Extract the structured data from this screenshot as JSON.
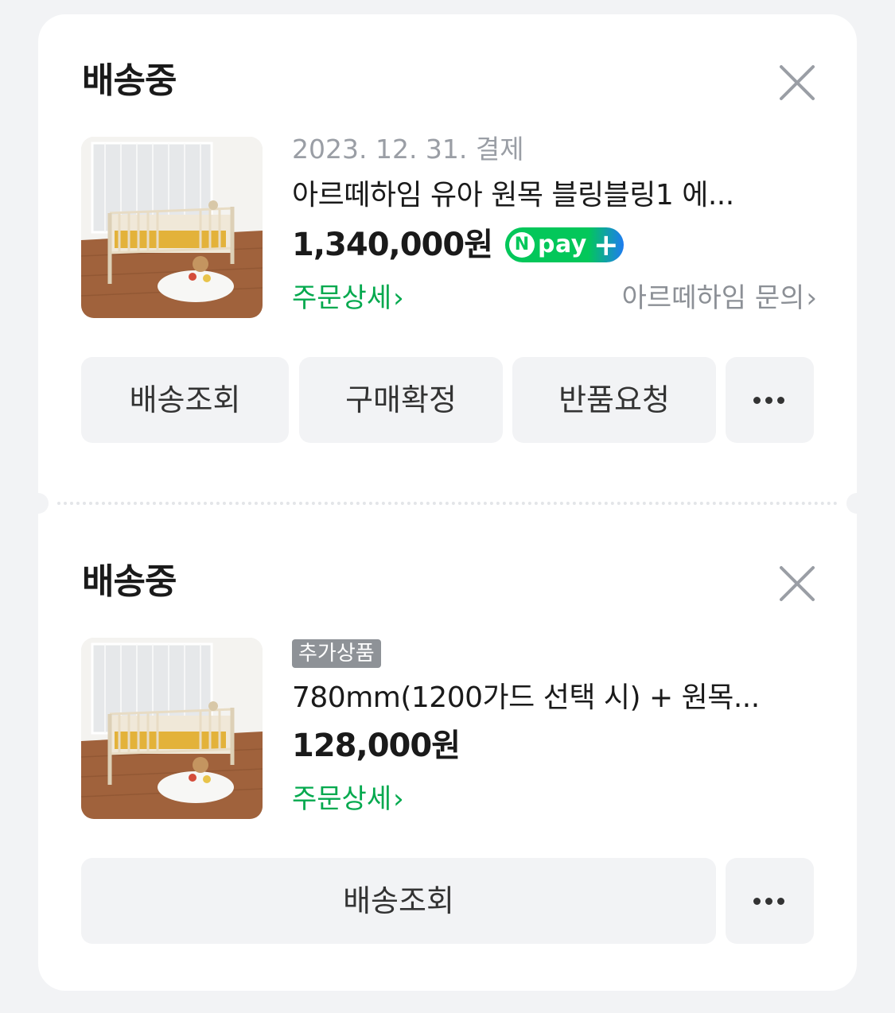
{
  "orders": [
    {
      "status": "배송중",
      "date": "2023. 12. 31. 결제",
      "product_name": "아르떼하임 유아 원목 블링블링1 에...",
      "price": "1,340,000원",
      "npay": {
        "n": "N",
        "text": "pay",
        "plus": "+"
      },
      "order_detail_link": "주문상세",
      "seller_inquiry_link": "아르떼하임 문의",
      "buttons": [
        "배송조회",
        "구매확정",
        "반품요청"
      ],
      "icons": {
        "close": "close-icon",
        "more": "more-icon",
        "thumbnail": "crib-bed-photo"
      }
    },
    {
      "status": "배송중",
      "tag": "추가상품",
      "product_name": "780mm(1200가드 선택 시) + 원목...",
      "price": "128,000원",
      "order_detail_link": "주문상세",
      "buttons": [
        "배송조회"
      ],
      "icons": {
        "close": "close-icon",
        "more": "more-icon",
        "thumbnail": "crib-bed-photo"
      }
    }
  ],
  "colors": {
    "accent_green": "#03a94e",
    "npay_green": "#03c75a",
    "npay_blue": "#1e7cf0",
    "background": "#f2f3f5"
  }
}
